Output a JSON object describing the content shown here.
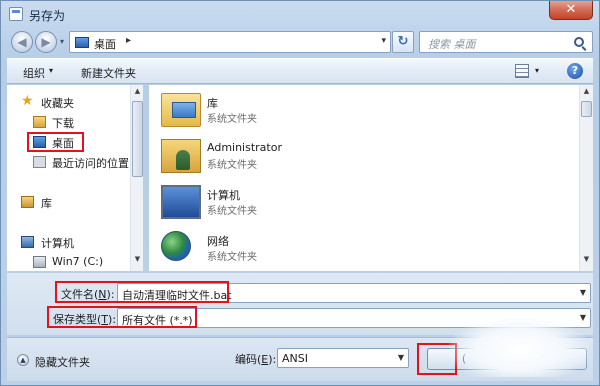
{
  "window": {
    "title": "另存为",
    "close_glyph": "✕"
  },
  "address_bar": {
    "path_segment": "桌面",
    "separator": "▸",
    "dropdown": "▾"
  },
  "navigation": {
    "back": "◀",
    "forward": "▶",
    "history_dropdown": "▾",
    "refresh": "↻"
  },
  "search": {
    "placeholder": "搜索 桌面"
  },
  "toolbar": {
    "organize_label": "组织",
    "organize_arrow": "▾",
    "new_folder_label": "新建文件夹",
    "view_arrow": "▾",
    "help_glyph": "?"
  },
  "sidebar": {
    "favorites_label": "收藏夹",
    "items": [
      {
        "label": "下载",
        "icon": "downloads-folder-icon"
      },
      {
        "label": "桌面",
        "icon": "desktop-icon"
      },
      {
        "label": "最近访问的位置",
        "icon": "recent-places-icon"
      }
    ],
    "libraries_label": "库",
    "computer_label": "计算机",
    "drive_label": "Win7 (C:)"
  },
  "files": [
    {
      "name": "库",
      "type": "系统文件夹",
      "icon": "libraries-folder-icon"
    },
    {
      "name": "Administrator",
      "type": "系统文件夹",
      "icon": "user-folder-icon"
    },
    {
      "name": "计算机",
      "type": "系统文件夹",
      "icon": "computer-icon"
    },
    {
      "name": "网络",
      "type": "系统文件夹",
      "icon": "network-globe-icon"
    }
  ],
  "form": {
    "filename_label": "文件名(",
    "filename_key": "N",
    "filename_suffix": "):",
    "filename_value": "自动清理临时文件.bat",
    "filetype_label": "保存类型(",
    "filetype_key": "T",
    "filetype_suffix": "):",
    "filetype_value": "所有文件 (*.*)"
  },
  "footer": {
    "hide_folders_label": "隐藏文件夹",
    "hide_folders_glyph": "▲",
    "encoding_label": "编码(",
    "encoding_key": "E",
    "encoding_suffix": "):",
    "encoding_value": "ANSI",
    "save_button_fragment": "("
  },
  "highlight_color": "#e0141a",
  "scroll_glyphs": {
    "up": "▲",
    "down": "▼"
  }
}
